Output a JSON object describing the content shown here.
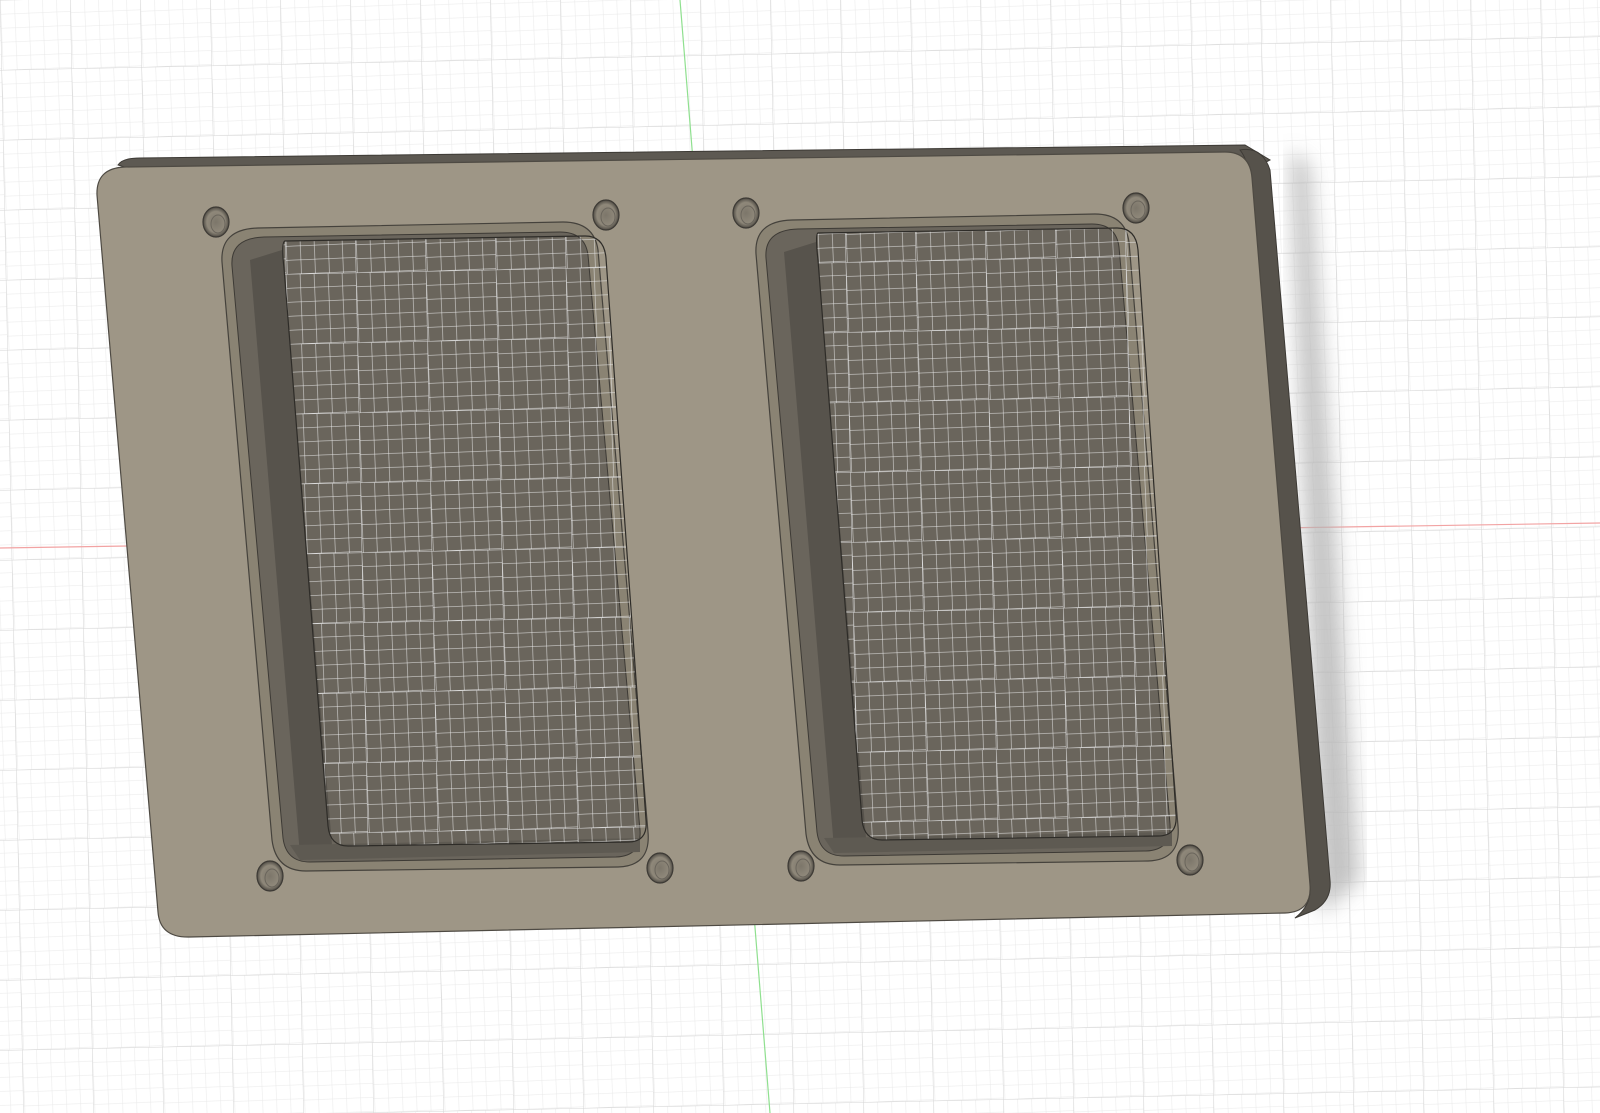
{
  "viewport": {
    "background_color": "#ffffff",
    "grid": {
      "visible": true,
      "minor_color": "#e6e6e6",
      "major_color": "#cfcfcf"
    },
    "axes": {
      "x_axis_color": "#f2a3a3",
      "y_axis_color": "#8fe08f"
    }
  },
  "model": {
    "type": "plate",
    "face_color": "#9d9585",
    "edge_color": "#4e4a43",
    "side_color": "#5b5750",
    "cutout_wall_color": "#57534c",
    "openings": 2,
    "holes_per_opening": 4,
    "shadow_color": "#bdbdbd"
  }
}
